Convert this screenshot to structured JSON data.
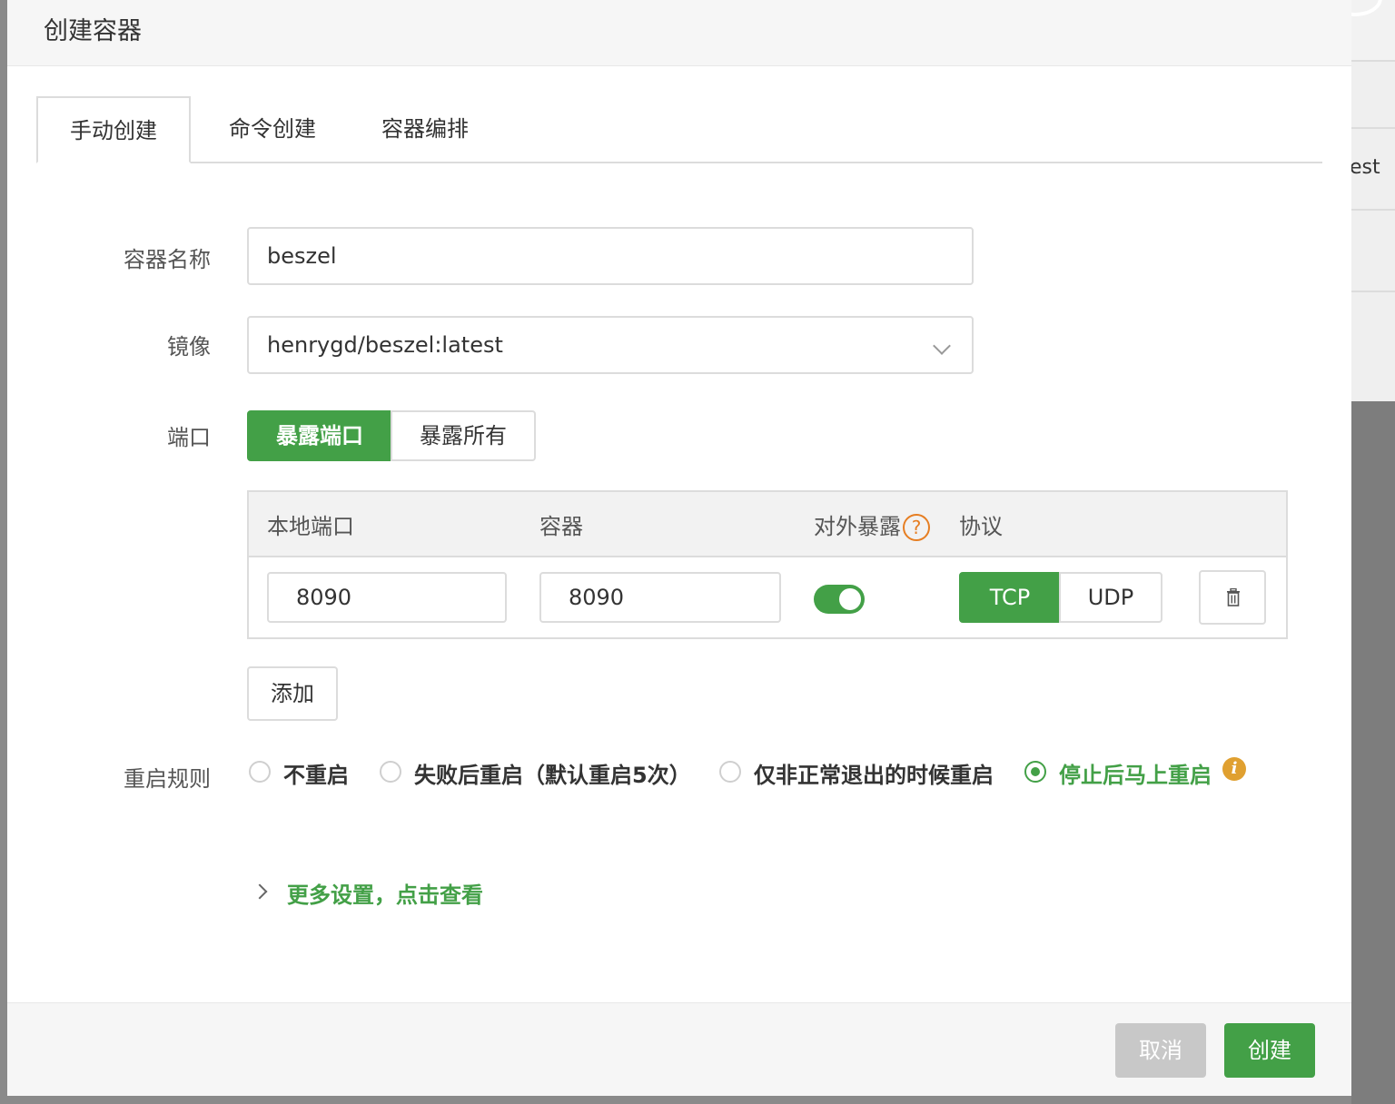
{
  "background": {
    "row_text": "est"
  },
  "dialog": {
    "title": "创建容器",
    "tabs": [
      {
        "label": "手动创建",
        "active": true
      },
      {
        "label": "命令创建",
        "active": false
      },
      {
        "label": "容器编排",
        "active": false
      }
    ],
    "form": {
      "name_label": "容器名称",
      "name_value": "beszel",
      "image_label": "镜像",
      "image_value": "henrygd/beszel:latest",
      "port_label": "端口",
      "port_modes": [
        {
          "label": "暴露端口",
          "selected": true
        },
        {
          "label": "暴露所有",
          "selected": false
        }
      ],
      "port_table": {
        "headers": {
          "local": "本地端口",
          "container": "容器",
          "expose": "对外暴露",
          "protocol": "协议"
        },
        "help_icon": "?",
        "rows": [
          {
            "local": "8090",
            "container": "8090",
            "expose": true,
            "protocols": [
              "TCP",
              "UDP"
            ],
            "selected_protocol": "TCP"
          }
        ]
      },
      "add_label": "添加",
      "restart_label": "重启规则",
      "restart_options": [
        {
          "label": "不重启",
          "selected": false
        },
        {
          "label": "失败后重启（默认重启5次）",
          "selected": false
        },
        {
          "label": "仅非正常退出的时候重启",
          "selected": false
        },
        {
          "label": "停止后马上重启",
          "selected": true
        }
      ],
      "info_icon": "i",
      "more_settings": "更多设置，点击查看"
    },
    "footer": {
      "cancel": "取消",
      "create": "创建"
    }
  },
  "colors": {
    "accent": "#43a047",
    "help": "#e67e22",
    "info": "#e0a030",
    "disabled": "#c8c8c8"
  }
}
